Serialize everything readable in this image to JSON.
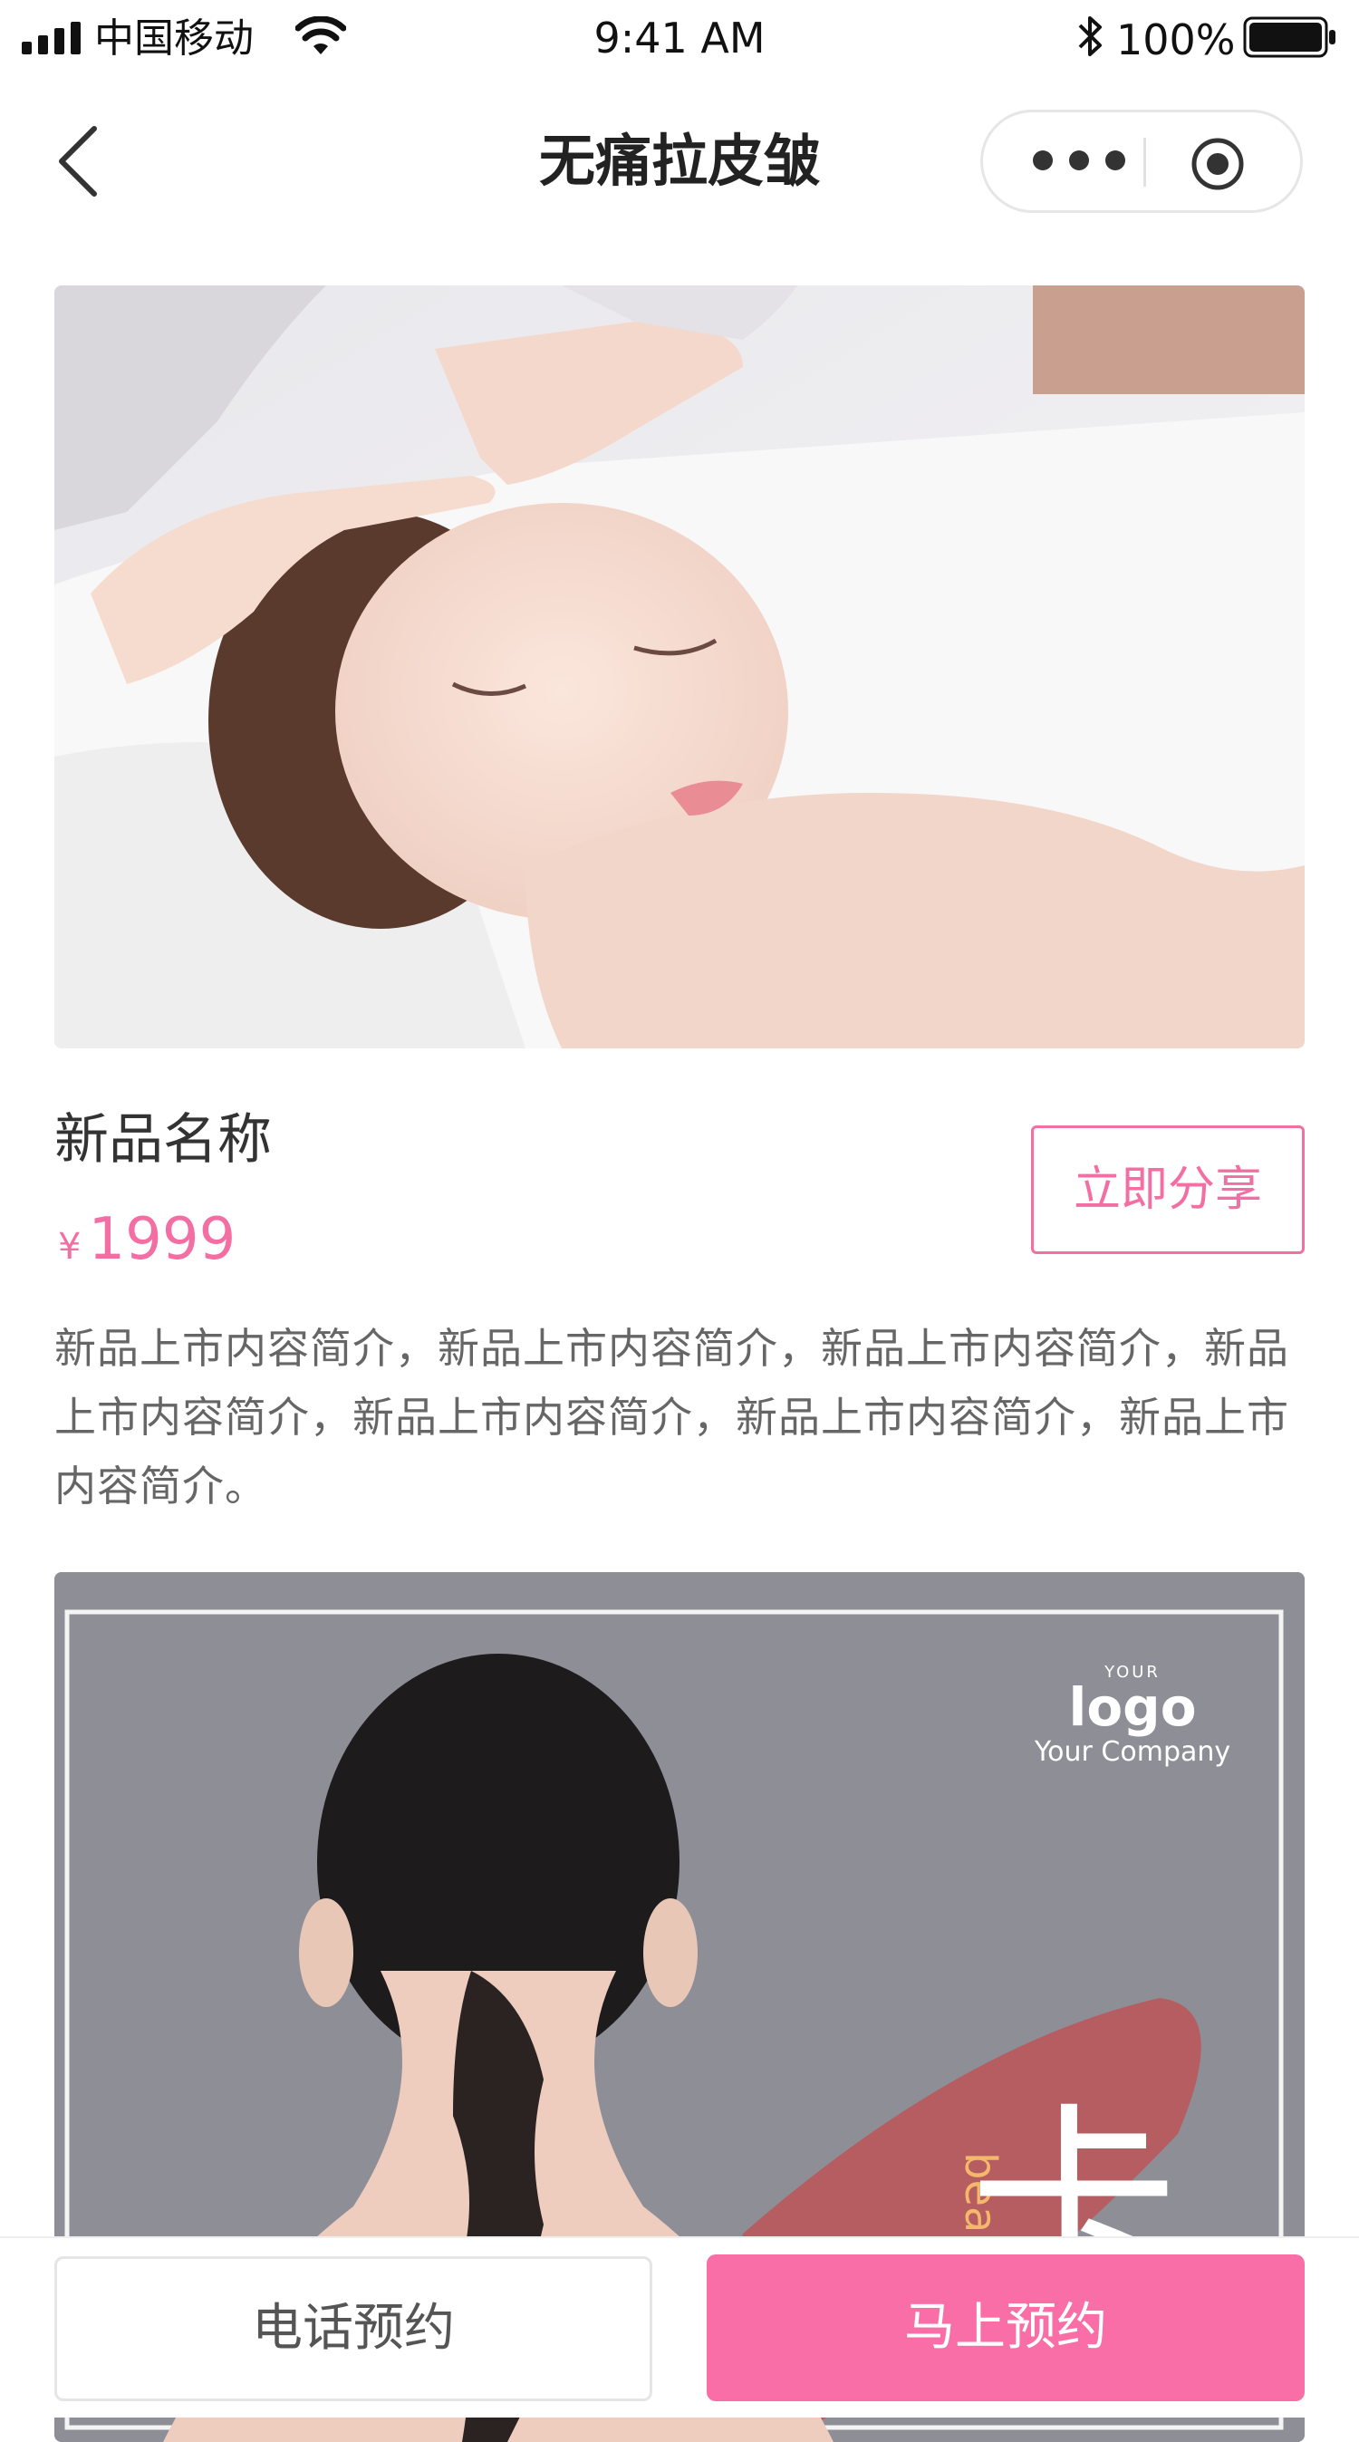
{
  "status_bar": {
    "carrier": "中国移动",
    "time": "9:41 AM",
    "battery": "100%"
  },
  "nav": {
    "title": "无痛拉皮皱",
    "back_icon": "chevron-left-icon",
    "more_icon": "more-dots-icon",
    "close_icon": "record-target-icon"
  },
  "product": {
    "name": "新品名称",
    "currency": "¥",
    "price": "1999",
    "share_label": "立即分享",
    "description": "新品上市内容简介，新品上市内容简介，新品上市内容简介，新品上市内容简介，新品上市内容简介，新品上市内容简介，新品上市内容简介。"
  },
  "promo_image": {
    "logo_small": "YOUR",
    "logo_big": "logo",
    "company": "Your Company"
  },
  "bottom_bar": {
    "call_label": "电话预约",
    "book_label": "马上预约"
  },
  "colors": {
    "accent": "#f36fa3",
    "primary_button": "#f96ea6",
    "text_dark": "#333333",
    "text_muted": "#666666"
  }
}
